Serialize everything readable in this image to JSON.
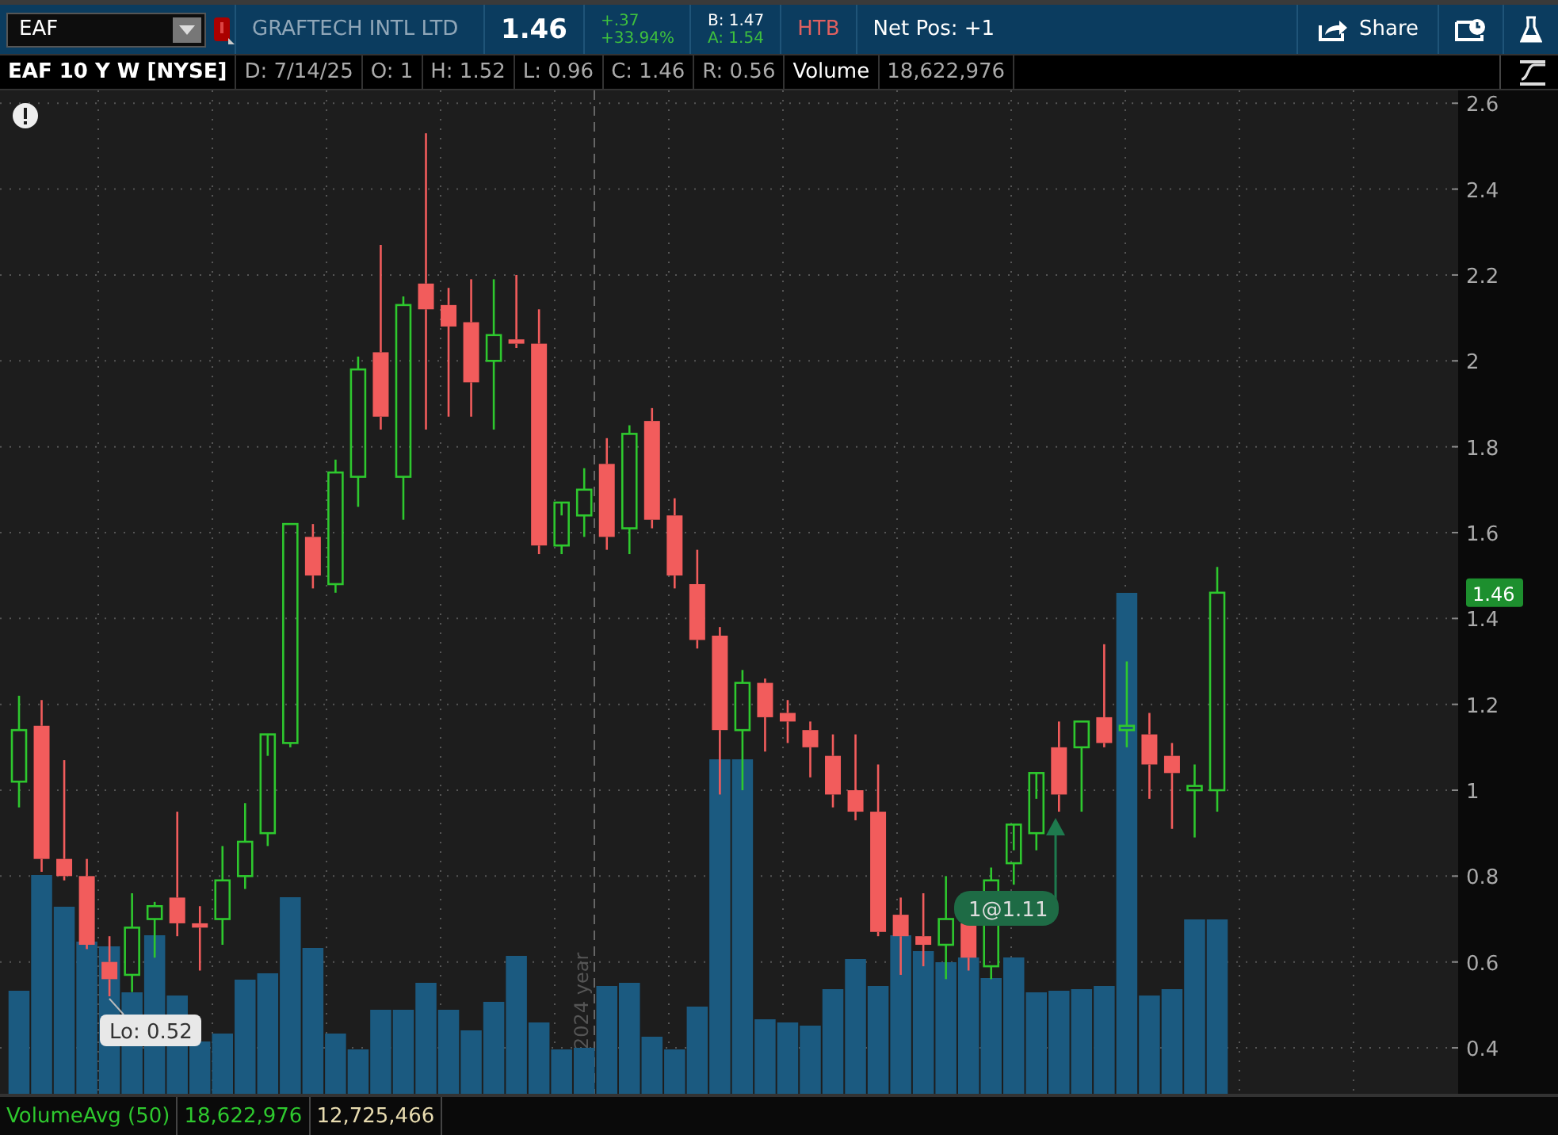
{
  "header": {
    "symbol": "EAF",
    "company": "GRAFTECH INTL LTD",
    "last": "1.46",
    "change": "+.37",
    "change_pct": "+33.94%",
    "bid": "B: 1.47",
    "ask": "A: 1.54",
    "htb": "HTB",
    "net_pos": "Net Pos: +1",
    "share": "Share"
  },
  "chart_header": {
    "title": "EAF 10 Y W [NYSE]",
    "fields": [
      "D: 7/14/25",
      "O: 1",
      "H: 1.52",
      "L: 0.96",
      "C: 1.46",
      "R: 0.56"
    ],
    "volume_label": "Volume",
    "volume_value": "18,622,976"
  },
  "chart": {
    "price_axis": [
      "2.6",
      "2.4",
      "2.2",
      "2",
      "1.8",
      "1.6",
      "1.4",
      "1.2",
      "1",
      "0.8",
      "0.6",
      "0.4"
    ],
    "year_marker": "2024 year",
    "low_label": "Lo: 0.52",
    "trade_label": "1@1.11",
    "price_tag": "1.46"
  },
  "volume_study": {
    "name": "VolumeAvg (50)",
    "value": "18,622,976",
    "average": "12,725,466"
  }
}
